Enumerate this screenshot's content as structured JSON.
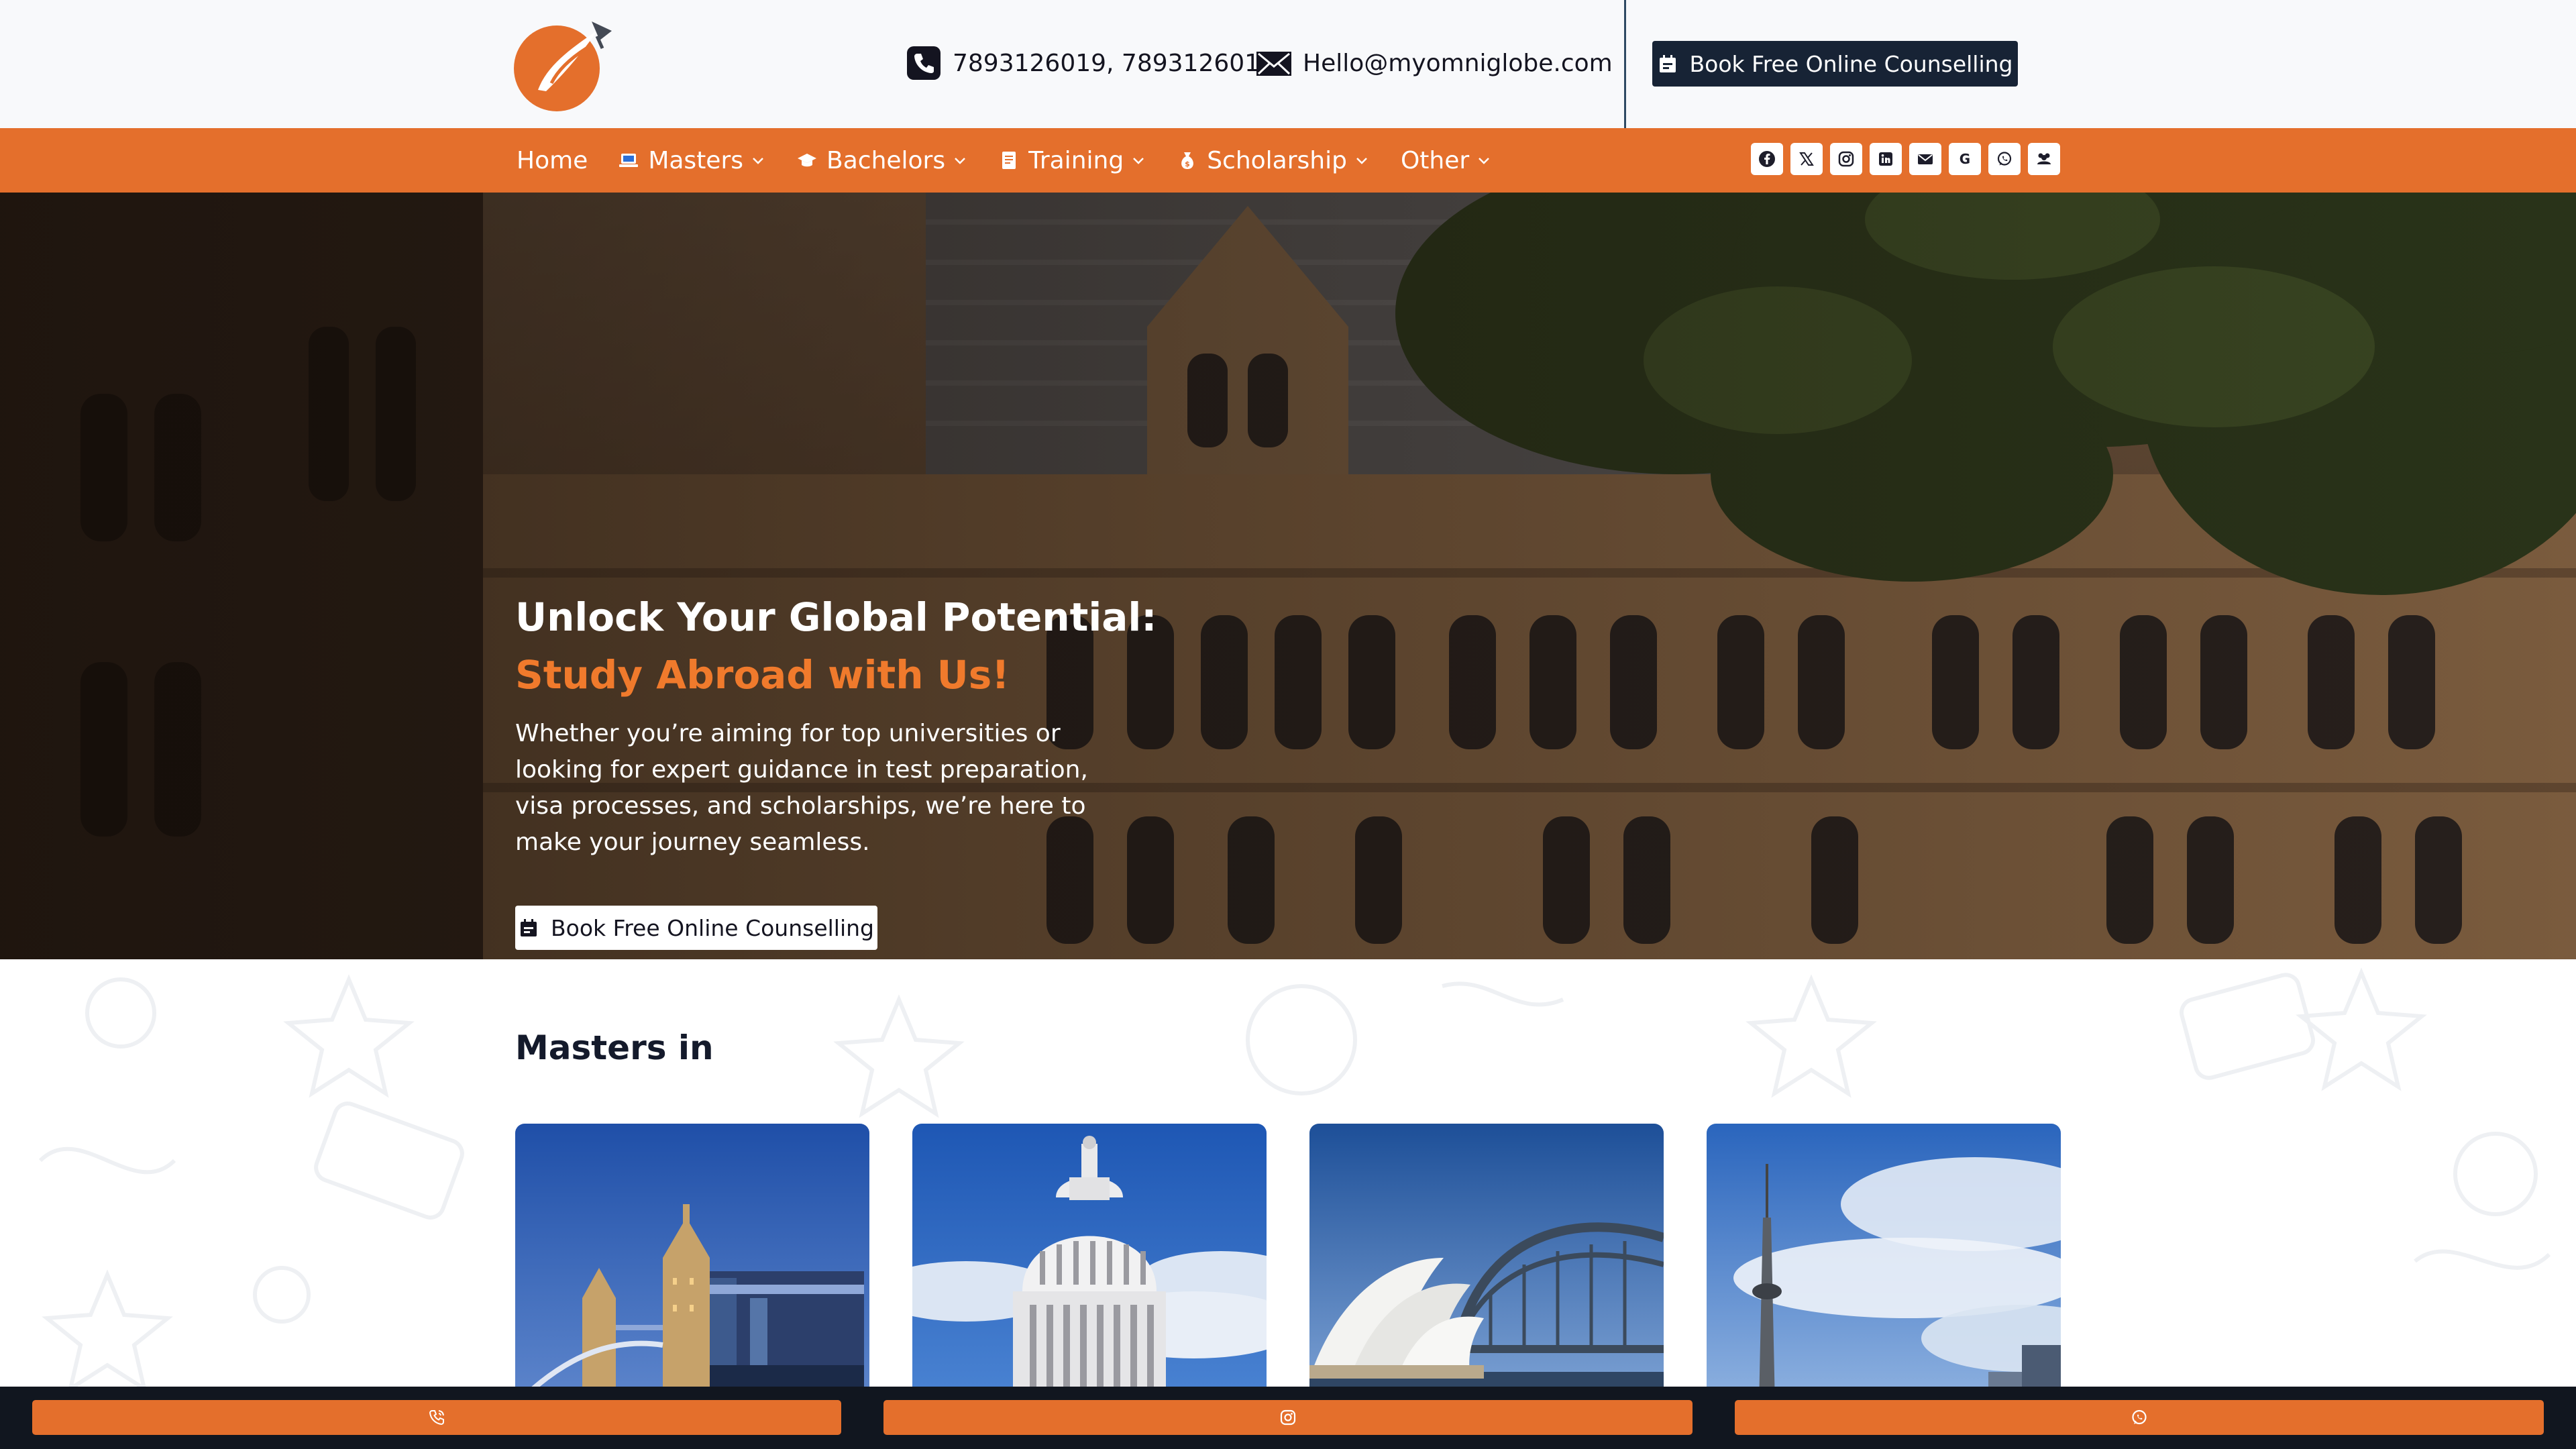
{
  "header": {
    "phone": "7893126019, 7893126015",
    "email": "Hello@myomniglobe.com",
    "cta_label": "Book Free Online Counselling"
  },
  "nav": {
    "items": [
      {
        "label": "Home",
        "icon": ""
      },
      {
        "label": "Masters",
        "icon": "laptop-icon"
      },
      {
        "label": "Bachelors",
        "icon": "graduation-cap-icon"
      },
      {
        "label": "Training",
        "icon": "document-icon"
      },
      {
        "label": "Scholarship",
        "icon": "money-bag-icon"
      },
      {
        "label": "Other",
        "icon": ""
      }
    ],
    "socials": [
      "facebook-icon",
      "x-icon",
      "instagram-icon",
      "linkedin-icon",
      "mail-icon",
      "google-icon",
      "whatsapp-icon",
      "group-icon"
    ]
  },
  "hero": {
    "title_line1": "Unlock Your Global Potential:",
    "title_line2": "Study Abroad with Us!",
    "description": "Whether you’re aiming for top universities or looking for expert guidance in test preparation, visa processes, and scholarships, we’re here to make your journey seamless.",
    "cta_label": "Book Free Online Counselling"
  },
  "masters": {
    "title": "Masters in",
    "cards": [
      {
        "image": "london-tower-bridge"
      },
      {
        "image": "us-capitol"
      },
      {
        "image": "sydney-opera-house"
      },
      {
        "image": "toronto-cn-tower"
      }
    ]
  },
  "bottom_bar": {
    "buttons": [
      "phone-icon",
      "instagram-icon",
      "whatsapp-icon"
    ]
  },
  "colors": {
    "accent": "#e46f2c",
    "dark": "#172335",
    "hero_accent": "#f07a2c"
  }
}
